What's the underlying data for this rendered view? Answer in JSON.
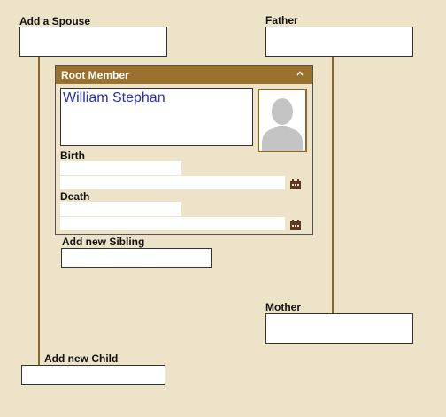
{
  "spouse": {
    "label": "Add a Spouse"
  },
  "father": {
    "label": "Father"
  },
  "mother": {
    "label": "Mother"
  },
  "sibling": {
    "label": "Add new Sibling"
  },
  "child": {
    "label": "Add new Child"
  },
  "root": {
    "title": "Root Member",
    "name": "William Stephan",
    "birth_label": "Birth",
    "death_label": "Death"
  },
  "colors": {
    "background": "#ece3c9",
    "header": "#99732e",
    "connector": "#8a6a2c",
    "name_text": "#2a2fb0"
  },
  "icons": [
    "collapse-up-icon",
    "calendar-icon",
    "avatar-silhouette-icon"
  ]
}
